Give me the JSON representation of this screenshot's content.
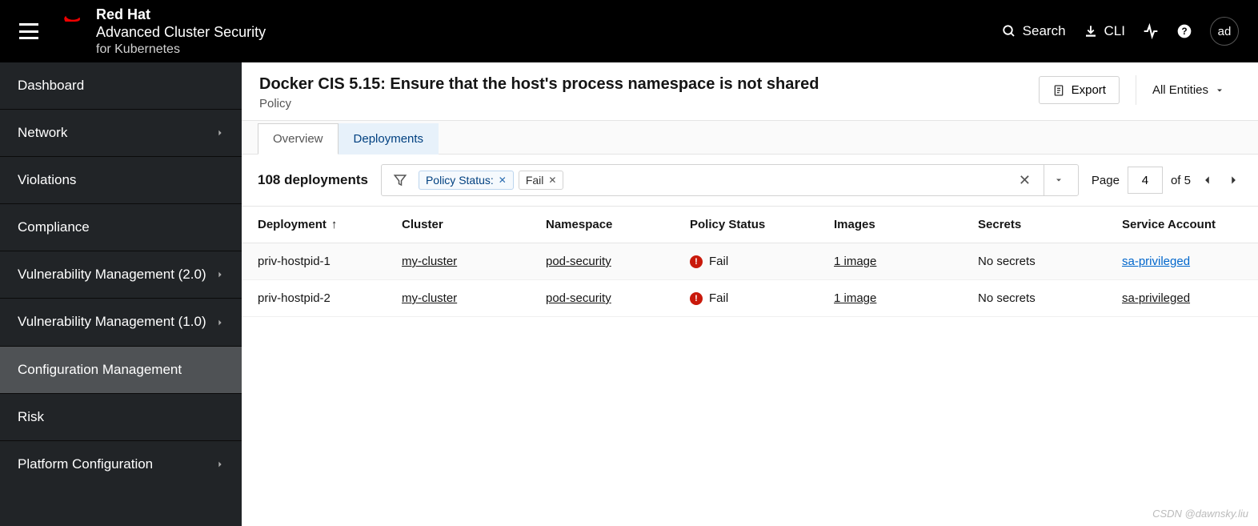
{
  "brand": {
    "line1": "Red Hat",
    "line2": "Advanced Cluster Security",
    "line3": "for Kubernetes"
  },
  "topbar": {
    "search": "Search",
    "cli": "CLI",
    "avatar": "ad"
  },
  "sidebar": {
    "items": [
      {
        "label": "Dashboard",
        "expandable": false
      },
      {
        "label": "Network",
        "expandable": true
      },
      {
        "label": "Violations",
        "expandable": false
      },
      {
        "label": "Compliance",
        "expandable": false
      },
      {
        "label": "Vulnerability Management (2.0)",
        "expandable": true
      },
      {
        "label": "Vulnerability Management (1.0)",
        "expandable": true
      },
      {
        "label": "Configuration Management",
        "expandable": false,
        "active": true
      },
      {
        "label": "Risk",
        "expandable": false
      },
      {
        "label": "Platform Configuration",
        "expandable": true
      }
    ]
  },
  "page": {
    "title": "Docker CIS 5.15: Ensure that the host's process namespace is not shared",
    "subtitle": "Policy",
    "export": "Export",
    "entities": "All Entities"
  },
  "tabs": {
    "overview": "Overview",
    "deployments": "Deployments"
  },
  "toolbar": {
    "count": "108 deployments",
    "filter_label": "Policy Status:",
    "filter_value": "Fail",
    "page_label": "Page",
    "page_current": "4",
    "page_total": "of 5"
  },
  "columns": {
    "deployment": "Deployment",
    "cluster": "Cluster",
    "namespace": "Namespace",
    "policy_status": "Policy Status",
    "images": "Images",
    "secrets": "Secrets",
    "service_account": "Service Account"
  },
  "rows": [
    {
      "deployment": "priv-hostpid-1",
      "cluster": "my-cluster",
      "namespace": "pod-security",
      "status": "Fail",
      "images": "1 image",
      "secrets": "No secrets",
      "service_account": "sa-privileged",
      "sa_highlight": true
    },
    {
      "deployment": "priv-hostpid-2",
      "cluster": "my-cluster",
      "namespace": "pod-security",
      "status": "Fail",
      "images": "1 image",
      "secrets": "No secrets",
      "service_account": "sa-privileged",
      "sa_highlight": false
    }
  ],
  "watermark": "CSDN @dawnsky.liu"
}
